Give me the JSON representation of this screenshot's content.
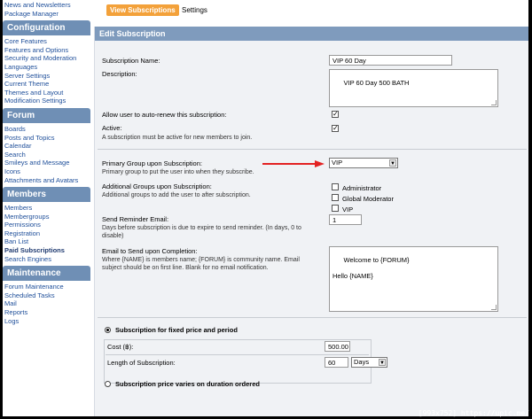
{
  "sidebar": {
    "top_items": [
      "News and Newsletters",
      "Package Manager"
    ],
    "sections": [
      {
        "title": "Configuration",
        "items": [
          "Core Features",
          "Features and Options",
          "Security and Moderation",
          "Languages",
          "Server Settings",
          "Current Theme",
          "Themes and Layout",
          "Modification Settings"
        ]
      },
      {
        "title": "Forum",
        "items": [
          "Boards",
          "Posts and Topics",
          "Calendar",
          "Search",
          "Smileys and Message",
          "Icons",
          "Attachments and Avatars"
        ]
      },
      {
        "title": "Members",
        "items": [
          "Members",
          "Membergroups",
          "Permissions",
          "Registration",
          "Ban List",
          "Paid Subscriptions",
          "Search Engines"
        ]
      },
      {
        "title": "Maintenance",
        "items": [
          "Forum Maintenance",
          "Scheduled Tasks",
          "Mail",
          "Reports",
          "Logs"
        ]
      }
    ]
  },
  "tabs": {
    "active": "View Subscriptions",
    "other": "Settings"
  },
  "panel": {
    "title": "Edit Subscription",
    "name_label": "Subscription Name:",
    "name_value": "VIP 60 Day",
    "desc_label": "Description:",
    "desc_value": "VIP 60 Day 500 BATH",
    "renew_label": "Allow user to auto-renew this subscription:",
    "active_label": "Active:",
    "active_hint": "A subscription must be active for new members to join.",
    "primary_label": "Primary Group upon Subscription:",
    "primary_hint": "Primary group to put the user into when they subscribe.",
    "primary_value": "VIP",
    "additional_label": "Additional Groups upon Subscription:",
    "additional_hint": "Additional groups to add the user to after subscription.",
    "groups": [
      "Administrator",
      "Global Moderator",
      "VIP"
    ],
    "reminder_label": "Send Reminder Email:",
    "reminder_hint": "Days before subscription is due to expire to send reminder. (In days, 0 to disable)",
    "reminder_value": "1",
    "email_label": "Email to Send upon Completion:",
    "email_hint": "Where {NAME} is members name; {FORUM} is community name. Email subject should be on first line. Blank for no email notification.",
    "email_value": "Welcome to {FORUM}\n\nHello {NAME}",
    "fixed_label": "Subscription for fixed price and period",
    "cost_label": "Cost (฿):",
    "cost_value": "500.00",
    "length_label": "Length of Subscription:",
    "length_value": "60",
    "length_unit": "Days",
    "varies_label": "Subscription price varies on duration ordered"
  },
  "watermark": "[993x752] https://upic.me/",
  "colors": {
    "accent": "#f3a13a",
    "header": "#7f9bbd",
    "sidebar_head": "#6f8fb5",
    "arrow": "#e32222"
  }
}
